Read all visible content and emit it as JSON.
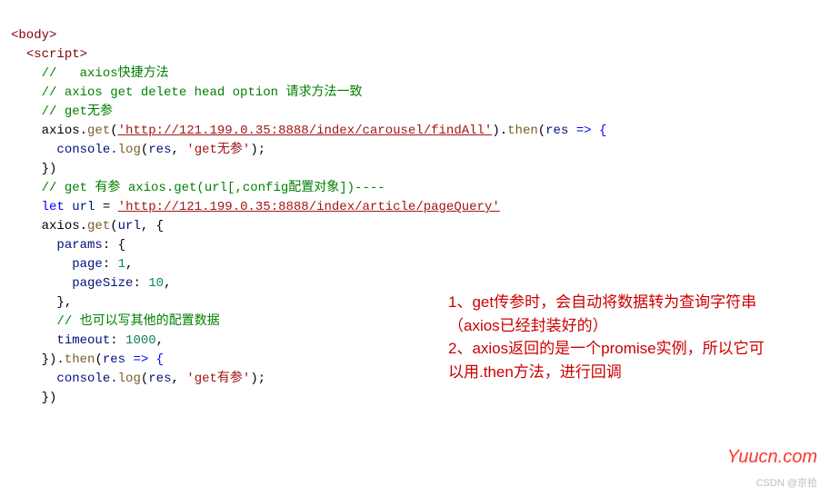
{
  "code": {
    "l1": "<body>",
    "l2": "<script>",
    "c1": "//   axios快捷方法",
    "c2": "// axios get delete head option 请求方法一致",
    "c3": "// get无参",
    "get1_prefix": "axios.",
    "get1_func": "get",
    "get1_url": "'http://121.199.0.35:8888/index/carousel/findAll'",
    "then": "then",
    "arrow_param": "res",
    "arrow": " => {",
    "console": "console.",
    "log": "log",
    "res": "res",
    "get1_label": "'get无参'",
    "close_brace_paren": "})",
    "c4": "// get 有参 axios.get(url[,config配置对象])----",
    "let": "let",
    "url_var": "url",
    "eq": " = ",
    "get2_url": "'http://121.199.0.35:8888/index/article/pageQuery'",
    "get2_prefix": "axios.",
    "get2_func": "get",
    "url_ref": "url",
    "comma_brace": ", {",
    "params_key": "params",
    "colon_brace": ": {",
    "page_key": "page",
    "page_val": "1",
    "pageSize_key": "pageSize",
    "pageSize_val": "10",
    "close_brace_comma": "},",
    "c5": "// 也可以写其他的配置数据",
    "timeout_key": "timeout",
    "timeout_val": "1000",
    "dot_then": ").",
    "get2_label": "'get有参'",
    "semicolon": ";"
  },
  "annotation": {
    "line1": "1、get传参时，会自动将数据转为查询字符串（axios已经封装好的）",
    "line2": "2、axios返回的是一个promise实例，所以它可以用.then方法，进行回调"
  },
  "watermark": "Yuucn.com",
  "csdn": "CSDN @京拾"
}
